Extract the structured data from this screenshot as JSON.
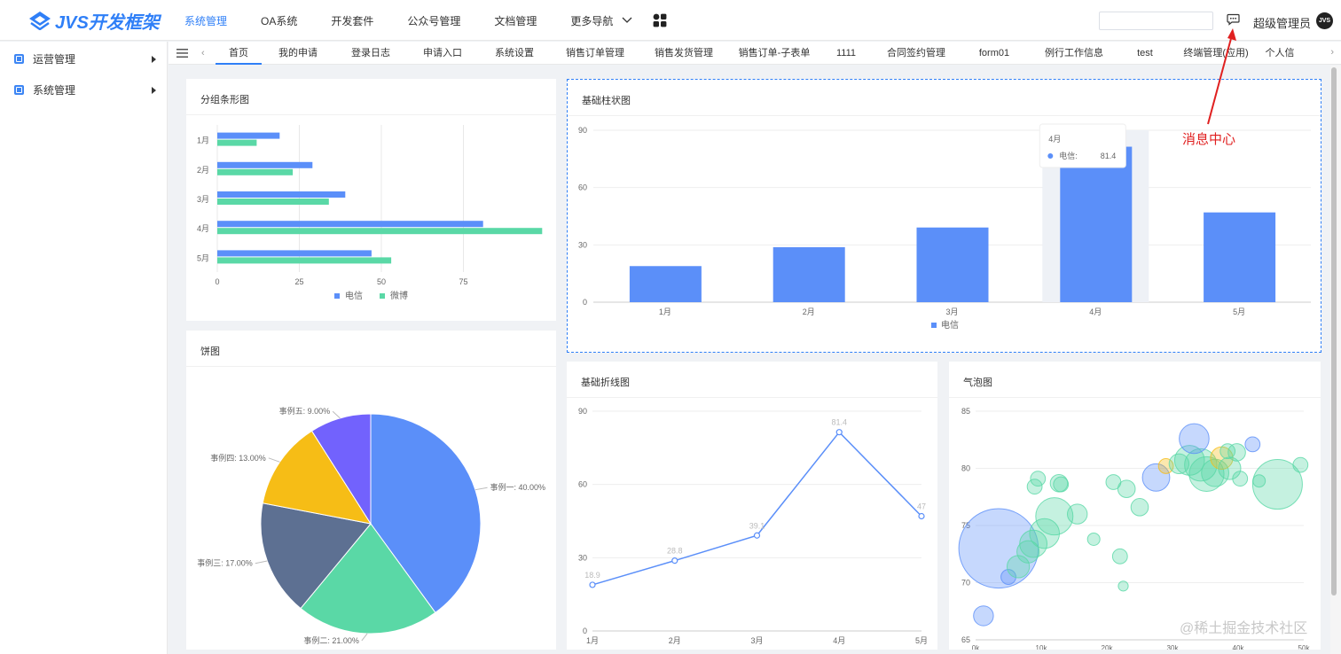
{
  "brand": {
    "logo_text": "JVS开发框架",
    "color": "#2f7ff7"
  },
  "header": {
    "nav": [
      {
        "label": "系统管理",
        "active": true
      },
      {
        "label": "OA系统"
      },
      {
        "label": "开发套件"
      },
      {
        "label": "公众号管理"
      },
      {
        "label": "文档管理"
      }
    ],
    "more_label": "更多导航",
    "user_name": "超级管理员",
    "avatar_text": "JVS"
  },
  "sidebar": {
    "items": [
      {
        "label": "运营管理"
      },
      {
        "label": "系统管理"
      }
    ]
  },
  "tabs": [
    "首页",
    "我的申请",
    "登录日志",
    "申请入口",
    "系统设置",
    "销售订单管理",
    "销售发货管理",
    "销售订单-子表单",
    "1111",
    "合同签约管理",
    "form01",
    "例行工作信息",
    "test",
    "终端管理(应用)",
    "个人信"
  ],
  "annotation": {
    "label": "消息中心",
    "color": "#e02020"
  },
  "watermark": "@稀土掘金技术社区",
  "panels": {
    "group_bar": {
      "title": "分组条形图"
    },
    "basic_bar": {
      "title": "基础柱状图"
    },
    "pie": {
      "title": "饼图"
    },
    "line": {
      "title": "基础折线图"
    },
    "bubble": {
      "title": "气泡图"
    }
  },
  "chart_data": [
    {
      "type": "bar",
      "orientation": "horizontal",
      "title": "分组条形图",
      "categories": [
        "1月",
        "2月",
        "3月",
        "4月",
        "5月"
      ],
      "series": [
        {
          "name": "电信",
          "values": [
            19,
            29,
            39,
            81,
            47
          ],
          "color": "#5b8ff9"
        },
        {
          "name": "微博",
          "values": [
            12,
            23,
            34,
            99,
            53
          ],
          "color": "#5ad8a6"
        }
      ],
      "xticks": [
        "0",
        "25",
        "50",
        "75"
      ],
      "xlim": [
        0,
        100
      ],
      "legend": "bottom"
    },
    {
      "type": "bar",
      "title": "基础柱状图",
      "categories": [
        "1月",
        "2月",
        "3月",
        "4月",
        "5月"
      ],
      "series": [
        {
          "name": "电信",
          "values": [
            18.9,
            28.8,
            39.1,
            81.4,
            47
          ],
          "color": "#5b8ff9"
        }
      ],
      "yticks": [
        "0",
        "30",
        "60",
        "90"
      ],
      "ylim": [
        0,
        90
      ],
      "legend": "bottom",
      "tooltip": {
        "category": "4月",
        "series": "电信",
        "value": "81.4"
      }
    },
    {
      "type": "pie",
      "title": "饼图",
      "slices": [
        {
          "label": "事例一: 40.00%",
          "value": 40,
          "color": "#5b8ff9"
        },
        {
          "label": "事例二: 21.00%",
          "value": 21,
          "color": "#5ad8a6"
        },
        {
          "label": "事例三: 17.00%",
          "value": 17,
          "color": "#5d7092"
        },
        {
          "label": "事例四: 13.00%",
          "value": 13,
          "color": "#f6bd16"
        },
        {
          "label": "事例五: 9.00%",
          "value": 9,
          "color": "#7262fd"
        }
      ]
    },
    {
      "type": "line",
      "title": "基础折线图",
      "categories": [
        "1月",
        "2月",
        "3月",
        "4月",
        "5月"
      ],
      "values": [
        18.9,
        28.8,
        39.1,
        81.4,
        47
      ],
      "point_labels": [
        "18.9",
        "28.8",
        "39.1",
        "81.4",
        "47"
      ],
      "yticks": [
        "0",
        "30",
        "60",
        "90"
      ],
      "ylim": [
        0,
        90
      ],
      "color": "#5b8ff9"
    },
    {
      "type": "scatter",
      "title": "气泡图",
      "yticks": [
        "65",
        "70",
        "75",
        "80",
        "85"
      ],
      "ylim": [
        65,
        85
      ],
      "xlim": [
        0,
        50
      ],
      "xticks": [
        "0k",
        "10k",
        "20k",
        "30k",
        "40k",
        "50k"
      ],
      "points": [
        {
          "x": 3.5,
          "y": 73,
          "r": 3.2,
          "c": "#5b8ff9"
        },
        {
          "x": 1.2,
          "y": 67.1,
          "r": 0.8,
          "c": "#5b8ff9"
        },
        {
          "x": 5,
          "y": 70.5,
          "r": 0.6,
          "c": "#5b8ff9"
        },
        {
          "x": 6.5,
          "y": 71.4,
          "r": 0.9,
          "c": "#5ad8a6"
        },
        {
          "x": 8,
          "y": 72.7,
          "r": 0.9,
          "c": "#5ad8a6"
        },
        {
          "x": 8.8,
          "y": 73.4,
          "r": 1.1,
          "c": "#5ad8a6"
        },
        {
          "x": 10.5,
          "y": 74.3,
          "r": 1.2,
          "c": "#5ad8a6"
        },
        {
          "x": 12,
          "y": 75.8,
          "r": 1.5,
          "c": "#5ad8a6"
        },
        {
          "x": 15.5,
          "y": 76,
          "r": 0.8,
          "c": "#5ad8a6"
        },
        {
          "x": 13,
          "y": 78.6,
          "r": 0.6,
          "c": "#5ad8a6"
        },
        {
          "x": 9,
          "y": 78.4,
          "r": 0.6,
          "c": "#5ad8a6"
        },
        {
          "x": 9.5,
          "y": 79.1,
          "r": 0.6,
          "c": "#5ad8a6"
        },
        {
          "x": 12.7,
          "y": 78.7,
          "r": 0.7,
          "c": "#5ad8a6"
        },
        {
          "x": 18,
          "y": 73.8,
          "r": 0.5,
          "c": "#5ad8a6"
        },
        {
          "x": 22,
          "y": 72.3,
          "r": 0.6,
          "c": "#5ad8a6"
        },
        {
          "x": 22.5,
          "y": 69.7,
          "r": 0.4,
          "c": "#5ad8a6"
        },
        {
          "x": 21,
          "y": 78.8,
          "r": 0.6,
          "c": "#5ad8a6"
        },
        {
          "x": 23,
          "y": 78.2,
          "r": 0.7,
          "c": "#5ad8a6"
        },
        {
          "x": 25,
          "y": 76.6,
          "r": 0.7,
          "c": "#5ad8a6"
        },
        {
          "x": 27.5,
          "y": 79.2,
          "r": 1.1,
          "c": "#5b8ff9"
        },
        {
          "x": 29,
          "y": 80.2,
          "r": 0.6,
          "c": "#f6bd16"
        },
        {
          "x": 31,
          "y": 80.4,
          "r": 0.8,
          "c": "#5ad8a6"
        },
        {
          "x": 32.6,
          "y": 80.7,
          "r": 1.2,
          "c": "#5ad8a6"
        },
        {
          "x": 34.3,
          "y": 80.3,
          "r": 1.3,
          "c": "#5ad8a6"
        },
        {
          "x": 33.3,
          "y": 82.6,
          "r": 1.2,
          "c": "#5b8ff9"
        },
        {
          "x": 35.2,
          "y": 79.5,
          "r": 1.4,
          "c": "#5ad8a6"
        },
        {
          "x": 36.5,
          "y": 79.6,
          "r": 1.1,
          "c": "#5ad8a6"
        },
        {
          "x": 37.5,
          "y": 80.9,
          "r": 0.9,
          "c": "#f6bd16"
        },
        {
          "x": 38.4,
          "y": 81.5,
          "r": 0.6,
          "c": "#5ad8a6"
        },
        {
          "x": 39.8,
          "y": 81.4,
          "r": 0.7,
          "c": "#5ad8a6"
        },
        {
          "x": 38.7,
          "y": 80,
          "r": 0.9,
          "c": "#5ad8a6"
        },
        {
          "x": 40.3,
          "y": 79.1,
          "r": 0.6,
          "c": "#5ad8a6"
        },
        {
          "x": 42.2,
          "y": 82.1,
          "r": 0.6,
          "c": "#5b8ff9"
        },
        {
          "x": 43.2,
          "y": 78.9,
          "r": 0.5,
          "c": "#5ad8a6"
        },
        {
          "x": 46,
          "y": 78.6,
          "r": 2.0,
          "c": "#5ad8a6"
        },
        {
          "x": 49.5,
          "y": 80.3,
          "r": 0.6,
          "c": "#5ad8a6"
        }
      ]
    }
  ]
}
